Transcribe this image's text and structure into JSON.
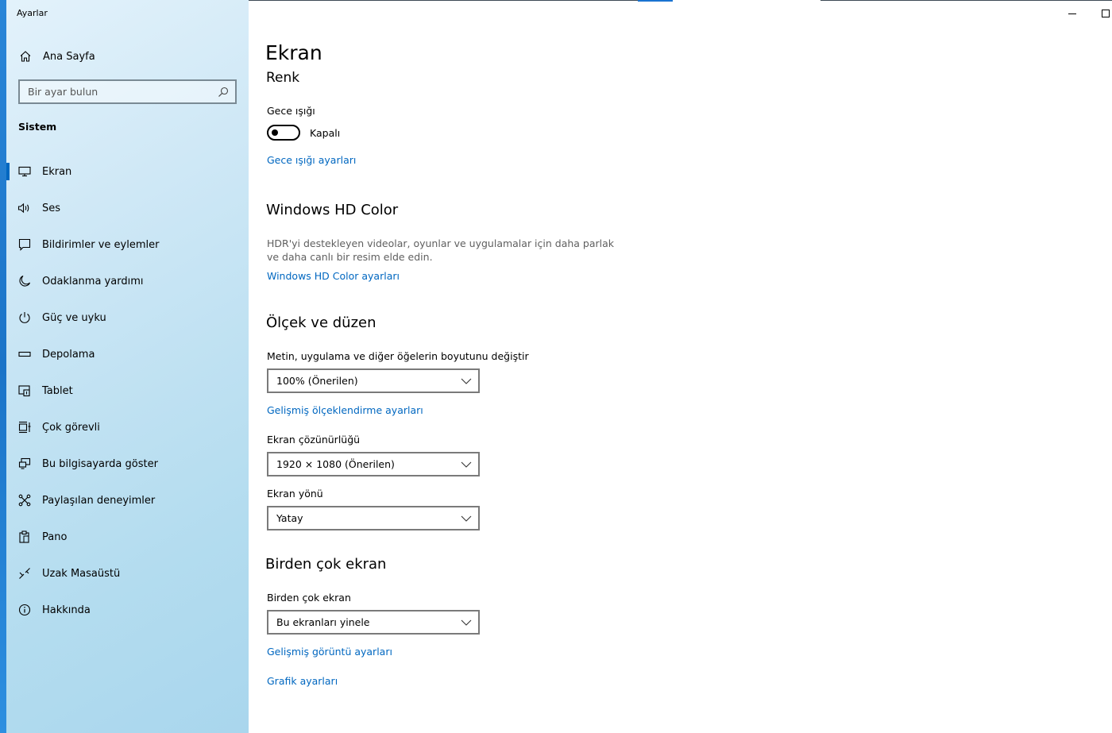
{
  "window": {
    "title": "Ayarlar"
  },
  "sidebar": {
    "home_label": "Ana Sayfa",
    "search_placeholder": "Bir ayar bulun",
    "section_title": "Sistem",
    "active_item": "Ekran",
    "items": [
      {
        "label": "Ekran",
        "icon": "monitor-icon"
      },
      {
        "label": "Ses",
        "icon": "speaker-icon"
      },
      {
        "label": "Bildirimler ve eylemler",
        "icon": "notification-icon"
      },
      {
        "label": "Odaklanma yardımı",
        "icon": "moon-icon"
      },
      {
        "label": "Güç ve uyku",
        "icon": "power-icon"
      },
      {
        "label": "Depolama",
        "icon": "storage-icon"
      },
      {
        "label": "Tablet",
        "icon": "tablet-icon"
      },
      {
        "label": "Çok görevli",
        "icon": "multitasking-icon"
      },
      {
        "label": "Bu bilgisayarda göster",
        "icon": "projecting-icon"
      },
      {
        "label": "Paylaşılan deneyimler",
        "icon": "shared-experiences-icon"
      },
      {
        "label": "Pano",
        "icon": "clipboard-icon"
      },
      {
        "label": "Uzak Masaüstü",
        "icon": "remote-desktop-icon"
      },
      {
        "label": "Hakkında",
        "icon": "info-icon"
      }
    ]
  },
  "main": {
    "page_title": "Ekran",
    "color_section": {
      "title": "Renk",
      "night_light_label": "Gece ışığı",
      "night_light_state": "Kapalı",
      "night_light_on": false,
      "night_light_link": "Gece ışığı ayarları"
    },
    "hd_color": {
      "title": "Windows HD Color",
      "description": "HDR'yi destekleyen videolar, oyunlar ve uygulamalar için daha parlak ve daha canlı bir resim elde edin.",
      "link": "Windows HD Color ayarları"
    },
    "scale_layout": {
      "title": "Ölçek ve düzen",
      "scale_label": "Metin, uygulama ve diğer öğelerin boyutunu değiştir",
      "scale_value": "100% (Önerilen)",
      "advanced_scaling_link": "Gelişmiş ölçeklendirme ayarları",
      "resolution_label": "Ekran çözünürlüğü",
      "resolution_value": "1920 × 1080 (Önerilen)",
      "orientation_label": "Ekran yönü",
      "orientation_value": "Yatay"
    },
    "multiple_displays": {
      "title": "Birden çok ekran",
      "label": "Birden çok ekran",
      "value": "Bu ekranları yinele",
      "advanced_display_link": "Gelişmiş görüntü ayarları",
      "graphics_link": "Grafik ayarları"
    }
  },
  "colors": {
    "accent": "#0067c0",
    "sidebar_bg": "#bfe1f2"
  }
}
